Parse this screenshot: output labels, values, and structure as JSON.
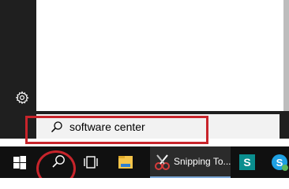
{
  "start_menu": {
    "settings_icon": "gear-icon"
  },
  "search": {
    "query": "software center",
    "icon": "magnifier-icon"
  },
  "taskbar": {
    "start_icon": "windows-logo-icon",
    "search_icon": "search-icon",
    "task_view_icon": "task-view-icon",
    "file_explorer_icon": "folder-icon",
    "snipping_label": "Snipping To...",
    "sway_icon": "sway-icon",
    "skype_icon": "skype-icon"
  },
  "colors": {
    "taskbar": "#101010",
    "start_rail": "#1f1f1f",
    "search_box": "#f2f2f2",
    "highlight_red": "#c8242b",
    "active_underline": "#7aa6d6",
    "folder_yellow": "#f6c54a",
    "sway_teal": "#0a8e8e",
    "skype_blue": "#1fa0e3"
  }
}
